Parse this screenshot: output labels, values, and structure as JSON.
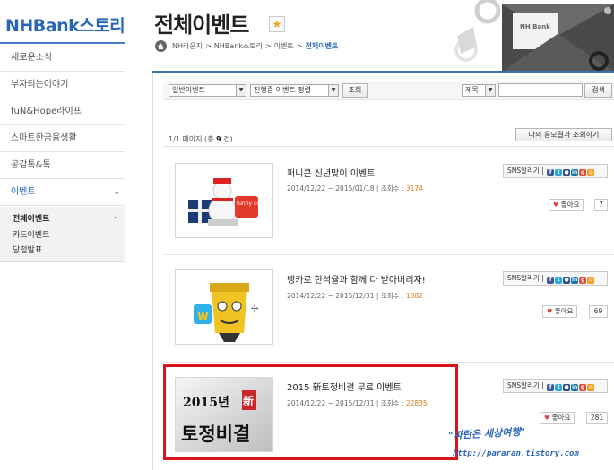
{
  "sidebar": {
    "brand": "NHBank스토리",
    "items": [
      {
        "label": "새로운소식"
      },
      {
        "label": "부자되는이야기"
      },
      {
        "label": "fuN&Hope라이프"
      },
      {
        "label": "스마트한금융생활"
      },
      {
        "label": "공감톡&톡"
      },
      {
        "label": "이벤트"
      }
    ],
    "subitems": [
      {
        "label": "전체이벤트"
      },
      {
        "label": "카드이벤트"
      },
      {
        "label": "당첨발표"
      }
    ]
  },
  "header": {
    "title": "전체이벤트",
    "breadcrumb": [
      "NH라운지",
      "NHBank스토리",
      "이벤트",
      "전체이벤트"
    ],
    "deco_label": "NH Bank"
  },
  "filters": {
    "type_select": "일반이벤트",
    "status_select": "진행중 이벤트 정렬",
    "search_button": "조회",
    "field_select": "제목",
    "search_input": "",
    "search_button2": "검색"
  },
  "list": {
    "page_info_prefix": "1/1 페이지 (총",
    "page_info_count": "9",
    "page_info_suffix": "건)",
    "my_entries_button": "나의 응모결과 조회하기"
  },
  "events": [
    {
      "title": "퍼니콘 신년맞이 이벤트",
      "period": "2014/12/22 ~ 2015/01/18",
      "views_label": "조회수 :",
      "views": "3174",
      "sns_label": "SNS알리기",
      "like_label": "좋아요",
      "likes": "7",
      "thumb": "funnycon-snowman-gift-image",
      "thumb_text": "funny con"
    },
    {
      "title": "뱅카로 한석율과 함께 다 받아버리자!",
      "period": "2014/12/22 ~ 2015/12/31",
      "views_label": "조회수 :",
      "views": "1882",
      "sns_label": "SNS알리기",
      "like_label": "좋아요",
      "likes": "69",
      "thumb": "banka-cartoon-character-image"
    },
    {
      "title": "2015 新토정비결 무료 이벤트",
      "period": "2014/12/22 ~ 2015/12/31",
      "views_label": "조회수 :",
      "views": "22835",
      "sns_label": "SNS알리기",
      "like_label": "좋아요",
      "likes": "281",
      "thumb": "tojeong-calligraphy-image",
      "thumb_text_1": "2015년",
      "thumb_text_2": "新",
      "thumb_text_3": "토정비결"
    }
  ],
  "watermark": {
    "line1": "\"파란은 세상여행\"",
    "line2": "http://pararan.tistory.com"
  },
  "colors": {
    "brand_blue": "#2a66b8",
    "highlight_red": "#d8141b",
    "views_orange": "#e07b1f"
  }
}
